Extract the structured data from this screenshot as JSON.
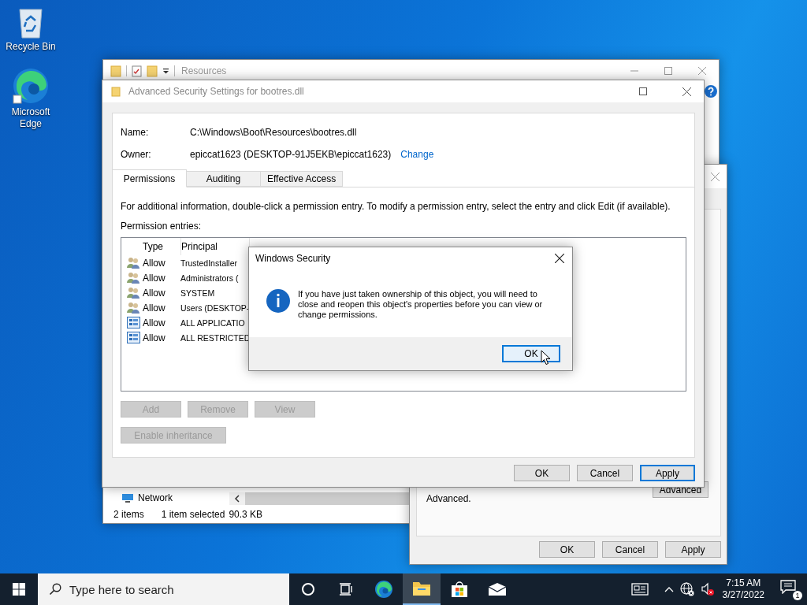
{
  "desktop_icons": [
    {
      "label": "Recycle Bin",
      "kind": "recycle"
    },
    {
      "label": "Microsoft Edge",
      "kind": "edge"
    }
  ],
  "explorer": {
    "title": "Resources",
    "nav_item": "Network",
    "status_items": "2 items",
    "status_selection": "1 item selected",
    "status_size": "90.3 KB"
  },
  "properties": {
    "hint": "Advanced.",
    "advanced_button": "Advanced",
    "buttons": [
      {
        "label": "OK",
        "default": false
      },
      {
        "label": "Cancel",
        "default": false
      },
      {
        "label": "Apply",
        "default": false
      }
    ]
  },
  "advanced": {
    "title": "Advanced Security Settings for bootres.dll",
    "name_label": "Name:",
    "name": "C:\\Windows\\Boot\\Resources\\bootres.dll",
    "owner_label": "Owner:",
    "owner": "epiccat1623 (DESKTOP-91J5EKB\\epiccat1623)",
    "change_link": "Change",
    "tabs": [
      {
        "label": "Permissions",
        "selected": true
      },
      {
        "label": "Auditing",
        "selected": false
      },
      {
        "label": "Effective Access",
        "selected": false
      }
    ],
    "info": "For additional information, double-click a permission entry. To modify a permission entry, select the entry and click Edit (if available).",
    "entries_label": "Permission entries:",
    "columns": [
      "Type",
      "Principal"
    ],
    "rows": [
      {
        "kind": "group",
        "type": "Allow",
        "principal": "TrustedInstaller"
      },
      {
        "kind": "group",
        "type": "Allow",
        "principal": "Administrators ("
      },
      {
        "kind": "group",
        "type": "Allow",
        "principal": "SYSTEM"
      },
      {
        "kind": "group",
        "type": "Allow",
        "principal": "Users (DESKTOP-"
      },
      {
        "kind": "package",
        "type": "Allow",
        "principal": "ALL APPLICATIO"
      },
      {
        "kind": "package",
        "type": "Allow",
        "principal": "ALL RESTRICTED"
      }
    ],
    "actions": [
      {
        "label": "Add",
        "disabled": true
      },
      {
        "label": "Remove",
        "disabled": true
      },
      {
        "label": "View",
        "disabled": true
      }
    ],
    "inheritance": {
      "label": "Enable inheritance",
      "disabled": true
    },
    "buttons": [
      {
        "label": "OK",
        "default": false
      },
      {
        "label": "Cancel",
        "default": false
      },
      {
        "label": "Apply",
        "default": true
      }
    ]
  },
  "dialog": {
    "title": "Windows Security",
    "message": "If you have just taken ownership of this object, you will need to close and reopen this object's properties before you can view or change permissions.",
    "button": {
      "label": "OK",
      "default": true
    }
  },
  "taskbar": {
    "search_placeholder": "Type here to search",
    "apps": [
      {
        "kind": "cortana",
        "active": false
      },
      {
        "kind": "taskview",
        "active": false
      },
      {
        "kind": "edge",
        "active": false
      },
      {
        "kind": "explorer",
        "active": true
      },
      {
        "kind": "store",
        "active": false
      },
      {
        "kind": "mail",
        "active": false
      }
    ],
    "time": "7:15 AM",
    "date": "3/27/2022",
    "notifications": "1"
  }
}
